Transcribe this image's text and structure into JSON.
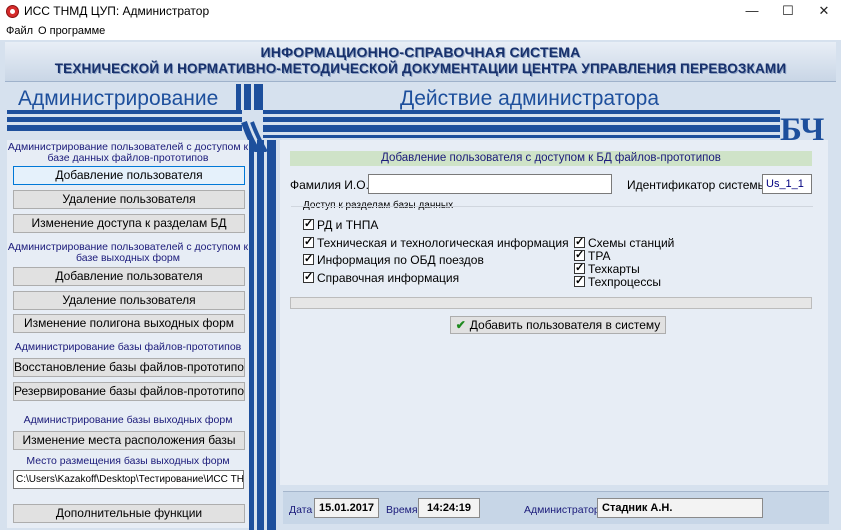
{
  "window": {
    "title": "ИСС ТНМД ЦУП: Администратор",
    "minimize": "—",
    "maximize": "☐",
    "close": "✕"
  },
  "menu": {
    "file": "Файл",
    "about": "О программе"
  },
  "header": {
    "line1": "ИНФОРМАЦИОННО-СПРАВОЧНАЯ СИСТЕМА",
    "line2": "ТЕХНИЧЕСКОЙ И НОРМАТИВНО-МЕТОДИЧЕСКОЙ ДОКУМЕНТАЦИИ ЦЕНТРА УПРАВЛЕНИЯ ПЕРЕВОЗКАМИ"
  },
  "left_title": "Администрирование",
  "right_title": "Действие администратора",
  "logo_text": "БЧ",
  "sidebar": {
    "section1_title": "Администрирование пользователей с доступом к базе данных файлов-прототипов",
    "s1_add": "Добавление пользователя",
    "s1_delete": "Удаление пользователя",
    "s1_access": "Изменение доступа к разделам БД",
    "section2_title": "Администрирование пользователей с доступом к базе выходных форм",
    "s2_add": "Добавление пользователя",
    "s2_delete": "Удаление пользователя",
    "s2_polygon": "Изменение полигона выходных форм",
    "section3_title": "Администрирование базы файлов-прототипов",
    "s3_restore": "Восстановление базы файлов-прототипов",
    "s3_backup": "Резервирование базы файлов-прототипов",
    "section4_title": "Администрирование базы выходных форм",
    "s4_location": "Изменение места расположения базы",
    "path_label": "Место размещения базы выходных форм",
    "path_value": "C:\\Users\\Kazakoff\\Desktop\\Тестирование\\ИСС ТНМД ЦУП",
    "extra": "Дополнительные функции"
  },
  "form": {
    "title": "Добавление пользователя с доступом к БД файлов-прототипов",
    "surname_label": "Фамилия И.О.",
    "surname_value": "",
    "sysid_label": "Идентификатор системы",
    "sysid_value": "Us_1_1",
    "access_group_label": "Доступ к разделам базы данных",
    "checkboxes": {
      "rd_tnpa": "РД и ТНПА",
      "technical": "Техническая и технологическая информация",
      "obd": "Информация по ОБД поездов",
      "reference": "Справочная информация",
      "station_schemes": "Схемы станций",
      "tra": "ТРА",
      "techcards": "Техкарты",
      "techprocesses": "Техпроцессы"
    },
    "add_button": "Добавить пользователя в систему"
  },
  "status": {
    "date_label": "Дата",
    "date_value": "15.01.2017",
    "time_label": "Время",
    "time_value": "14:24:19",
    "admin_label": "Администратор",
    "admin_value": "Стадник А.Н."
  },
  "colors": {
    "accent": "#1d4f9c",
    "panel": "#e7edf5",
    "header_text": "#17306b"
  }
}
